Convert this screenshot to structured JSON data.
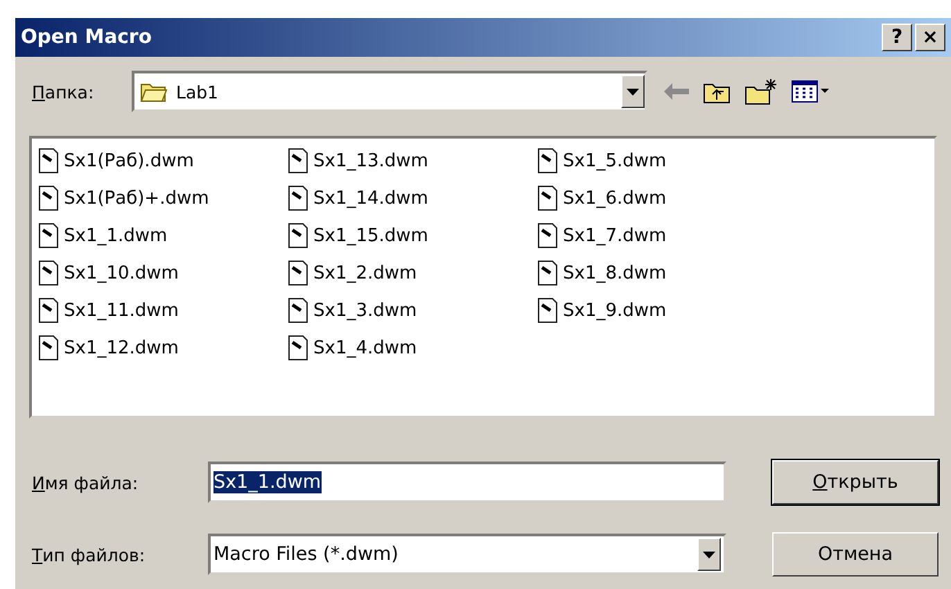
{
  "window": {
    "title": "Open Macro",
    "title_buttons": [
      "?",
      "×"
    ]
  },
  "folder": {
    "label": "Папка:",
    "first_letter_underlined": true,
    "value": "Lab1"
  },
  "files": [
    "Sx1(Раб).dwm",
    "Sx1(Раб)+.dwm",
    "Sx1_1.dwm",
    "Sx1_10.dwm",
    "Sx1_11.dwm",
    "Sx1_12.dwm",
    "Sx1_13.dwm",
    "Sx1_14.dwm",
    "Sx1_15.dwm",
    "Sx1_2.dwm",
    "Sx1_3.dwm",
    "Sx1_4.dwm",
    "Sx1_5.dwm",
    "Sx1_6.dwm",
    "Sx1_7.dwm",
    "Sx1_8.dwm",
    "Sx1_9.dwm"
  ],
  "file_name": {
    "label": "Имя файла:",
    "first_letter_underlined": true,
    "value": "Sx1_1.dwm",
    "text_selected": true
  },
  "file_type": {
    "label": "Тип файлов:",
    "first_letter_underlined": true,
    "value": "Macro Files (*.dwm)"
  },
  "buttons": [
    {
      "label": "Открыть",
      "first_letter_underlined": true,
      "default": true
    },
    {
      "label": "Отмена",
      "default": false
    }
  ]
}
